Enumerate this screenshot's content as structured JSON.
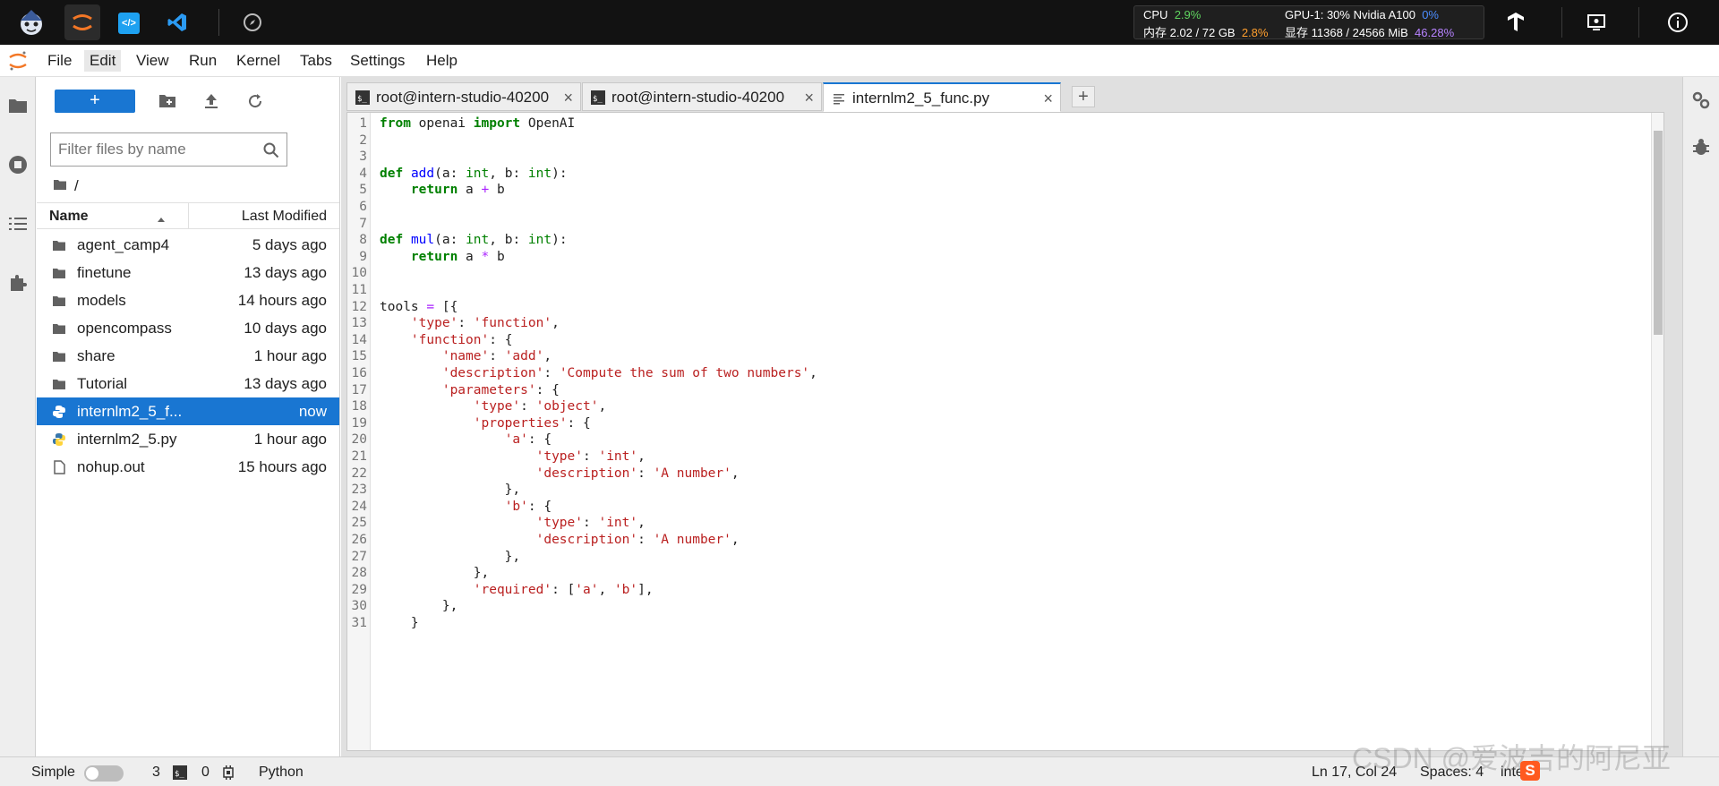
{
  "topbar": {
    "sysmon": {
      "cpu_label": "CPU",
      "cpu_value": "2.9%",
      "mem_label": "内存 2.02 / 72 GB",
      "mem_value": "2.8%",
      "gpu_label": "GPU-1: 30% Nvidia A100",
      "gpu_value": "0%",
      "vram_label": "显存 11368 / 24566 MiB",
      "vram_value": "46.28%"
    }
  },
  "menu": [
    "File",
    "Edit",
    "View",
    "Run",
    "Kernel",
    "Tabs",
    "Settings",
    "Help"
  ],
  "filebrowser": {
    "new_label": "+",
    "filter_placeholder": "Filter files by name",
    "breadcrumb": "/",
    "col_name": "Name",
    "col_modified": "Last Modified",
    "files": [
      {
        "name": "agent_camp4",
        "modified": "5 days ago",
        "type": "folder"
      },
      {
        "name": "finetune",
        "modified": "13 days ago",
        "type": "folder"
      },
      {
        "name": "models",
        "modified": "14 hours ago",
        "type": "folder"
      },
      {
        "name": "opencompass",
        "modified": "10 days ago",
        "type": "folder"
      },
      {
        "name": "share",
        "modified": "1 hour ago",
        "type": "folder"
      },
      {
        "name": "Tutorial",
        "modified": "13 days ago",
        "type": "folder"
      },
      {
        "name": "internlm2_5_f...",
        "modified": "now",
        "type": "python",
        "selected": true
      },
      {
        "name": "internlm2_5.py",
        "modified": "1 hour ago",
        "type": "python"
      },
      {
        "name": "nohup.out",
        "modified": "15 hours ago",
        "type": "file"
      }
    ]
  },
  "tabs": [
    {
      "label": "root@intern-studio-40200",
      "type": "terminal"
    },
    {
      "label": "root@intern-studio-40200",
      "type": "terminal"
    },
    {
      "label": "internlm2_5_func.py",
      "type": "editor",
      "active": true
    }
  ],
  "code_lines": [
    "from openai import OpenAI",
    "",
    "",
    "def add(a: int, b: int):",
    "    return a + b",
    "",
    "",
    "def mul(a: int, b: int):",
    "    return a * b",
    "",
    "",
    "tools = [{",
    "    'type': 'function',",
    "    'function': {",
    "        'name': 'add',",
    "        'description': 'Compute the sum of two numbers',",
    "        'parameters': {",
    "            'type': 'object',",
    "            'properties': {",
    "                'a': {",
    "                    'type': 'int',",
    "                    'description': 'A number',",
    "                },",
    "                'b': {",
    "                    'type': 'int',",
    "                    'description': 'A number',",
    "                },",
    "            },",
    "            'required': ['a', 'b'],",
    "        },",
    "    }"
  ],
  "statusbar": {
    "mode": "Simple",
    "count1": "3",
    "count2": "0",
    "kernel": "Python",
    "position": "Ln 17, Col 24",
    "spaces": "Spaces: 4",
    "lang_partial": "inte"
  },
  "watermark": "CSDN @爱波吉的阿尼亚",
  "colors": {
    "accent": "#1976d2",
    "topbar": "#121212",
    "keyword": "#008000",
    "string": "#ba2121",
    "function": "#0000ff",
    "operator": "#aa22ff"
  }
}
